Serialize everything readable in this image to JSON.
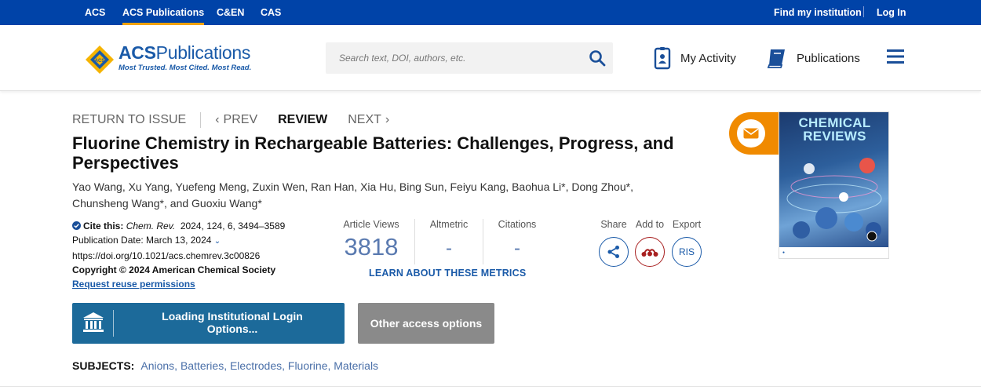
{
  "topbar": {
    "links": [
      "ACS",
      "ACS Publications",
      "C&EN",
      "CAS"
    ],
    "find_institution": "Find my institution",
    "login": "Log In"
  },
  "header": {
    "logo_brand_bold": "ACS",
    "logo_brand_rest": "Publications",
    "logo_tagline": "Most Trusted. Most Cited. Most Read.",
    "search_placeholder": "Search text, DOI, authors, etc.",
    "my_activity": "My Activity",
    "publications": "Publications"
  },
  "nav": {
    "return": "RETURN TO ISSUE",
    "prev": "PREV",
    "current": "REVIEW",
    "next": "NEXT"
  },
  "article": {
    "title": "Fluorine Chemistry in Rechargeable Batteries: Challenges, Progress, and Perspectives",
    "authors": "Yao Wang, Xu Yang, Yuefeng Meng, Zuxin Wen, Ran Han, Xia Hu, Bing Sun, Feiyu Kang, Baohua Li*, Dong Zhou*, Chunsheng Wang*, and Guoxiu Wang*",
    "cite_label": "Cite this:",
    "cite_journal": "Chem. Rev.",
    "cite_ref": "2024, 124, 6, 3494–3589",
    "pub_date": "Publication Date: March 13, 2024",
    "doi": "https://doi.org/10.1021/acs.chemrev.3c00826",
    "copyright": "Copyright © 2024 American Chemical Society",
    "reuse": "Request reuse permissions"
  },
  "metrics": {
    "views_label": "Article Views",
    "views_value": "3818",
    "altmetric_label": "Altmetric",
    "altmetric_value": "-",
    "citations_label": "Citations",
    "citations_value": "-",
    "learn": "LEARN ABOUT THESE METRICS"
  },
  "tools": {
    "share": "Share",
    "add_to": "Add to",
    "export": "Export",
    "ris": "RIS"
  },
  "access": {
    "institutional": "Loading Institutional Login Options...",
    "other": "Other access options"
  },
  "subjects": {
    "label": "SUBJECTS:",
    "items": "Anions, Batteries, Electrodes, Fluorine, Materials"
  },
  "cover": {
    "title_line1": "CHEMICAL",
    "title_line2": "REVIEWS"
  },
  "colors": {
    "topbar": "#0043a8",
    "accent": "#f5a300",
    "brand": "#1a5aa8",
    "inst_button": "#1c6a9a",
    "mail_tab": "#f08a00"
  }
}
